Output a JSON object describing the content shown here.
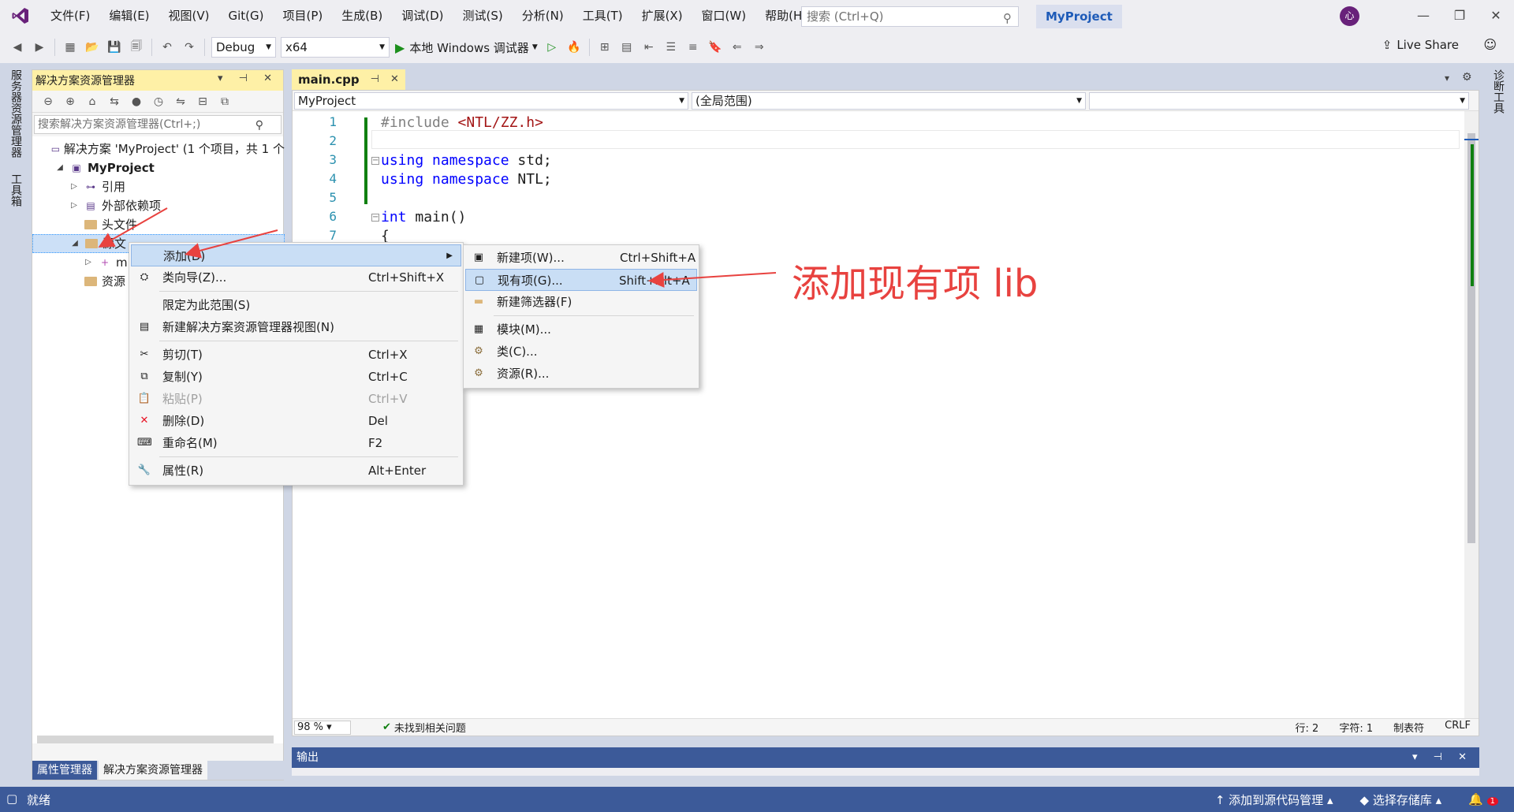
{
  "menu": [
    "文件(F)",
    "编辑(E)",
    "视图(V)",
    "Git(G)",
    "项目(P)",
    "生成(B)",
    "调试(D)",
    "测试(S)",
    "分析(N)",
    "工具(T)",
    "扩展(X)",
    "窗口(W)",
    "帮助(H)"
  ],
  "search": {
    "placeholder": "搜索 (Ctrl+Q)"
  },
  "project_title": "MyProject",
  "avatar_initial": "心",
  "toolbar": {
    "config": "Debug",
    "platform": "x64",
    "run_label": "本地 Windows 调试器",
    "live_share": "Live Share"
  },
  "left_tabs": [
    "服务器资源管理器",
    "工具箱"
  ],
  "right_tabs": [
    "诊断工具"
  ],
  "solution_explorer": {
    "title": "解决方案资源管理器",
    "search_placeholder": "搜索解决方案资源管理器(Ctrl+;)",
    "tree": [
      {
        "label": "解决方案 'MyProject' (1 个项目，共 1 个",
        "level": 0,
        "icon": "solution-icon",
        "expander": ""
      },
      {
        "label": "MyProject",
        "level": 1,
        "icon": "project-icon",
        "expander": "◢",
        "bold": true
      },
      {
        "label": "引用",
        "level": 2,
        "icon": "references-icon",
        "expander": "▷"
      },
      {
        "label": "外部依赖项",
        "level": 2,
        "icon": "external-deps-icon",
        "expander": "▷"
      },
      {
        "label": "头文件",
        "level": 2,
        "icon": "folder-icon",
        "expander": ""
      },
      {
        "label": "源文",
        "level": 2,
        "icon": "folder-icon",
        "expander": "◢",
        "selected": true
      },
      {
        "label": "m",
        "level": 3,
        "icon": "cpp-file-icon",
        "expander": "▷"
      },
      {
        "label": "资源",
        "level": 2,
        "icon": "folder-icon",
        "expander": ""
      }
    ],
    "bottom_tabs": [
      "属性管理器",
      "解决方案资源管理器"
    ]
  },
  "editor": {
    "tab": "main.cpp",
    "nav": {
      "project": "MyProject",
      "scope": "(全局范围)",
      "member": ""
    },
    "lines": [
      {
        "n": "1",
        "tokens": [
          {
            "t": "#include ",
            "c": "pp"
          },
          {
            "t": "<NTL/ZZ.h>",
            "c": "str"
          }
        ]
      },
      {
        "n": "2",
        "tokens": []
      },
      {
        "n": "3",
        "tokens": [
          {
            "t": "using",
            "c": "kw"
          },
          {
            "t": " "
          },
          {
            "t": "namespace",
            "c": "kw"
          },
          {
            "t": " std;"
          }
        ],
        "fold": true
      },
      {
        "n": "4",
        "tokens": [
          {
            "t": "using",
            "c": "kw"
          },
          {
            "t": " "
          },
          {
            "t": "namespace",
            "c": "kw"
          },
          {
            "t": " NTL;"
          }
        ]
      },
      {
        "n": "5",
        "tokens": []
      },
      {
        "n": "6",
        "tokens": [
          {
            "t": "int",
            "c": "kw"
          },
          {
            "t": " main()"
          }
        ],
        "fold": true
      },
      {
        "n": "7",
        "tokens": [
          {
            "t": "{"
          }
        ]
      }
    ],
    "status": {
      "zoom": "98 %",
      "issues": "未找到相关问题",
      "line": "行: 2",
      "char": "字符: 1",
      "tabs": "制表符",
      "eol": "CRLF"
    }
  },
  "output": {
    "title": "输出"
  },
  "statusbar": {
    "ready": "就绪",
    "source_control": "添加到源代码管理",
    "repo": "选择存储库",
    "notif_count": "1"
  },
  "context_menu": [
    {
      "label": "添加(D)",
      "shortcut": "",
      "icon": "",
      "submenu": true,
      "highlight": true
    },
    {
      "label": "类向导(Z)...",
      "shortcut": "Ctrl+Shift+X",
      "icon": "class-wizard-icon"
    },
    {
      "sep": true
    },
    {
      "label": "限定为此范围(S)",
      "shortcut": "",
      "icon": ""
    },
    {
      "label": "新建解决方案资源管理器视图(N)",
      "shortcut": "",
      "icon": "new-view-icon"
    },
    {
      "sep": true
    },
    {
      "label": "剪切(T)",
      "shortcut": "Ctrl+X",
      "icon": "cut-icon"
    },
    {
      "label": "复制(Y)",
      "shortcut": "Ctrl+C",
      "icon": "copy-icon"
    },
    {
      "label": "粘贴(P)",
      "shortcut": "Ctrl+V",
      "icon": "paste-icon",
      "disabled": true
    },
    {
      "label": "删除(D)",
      "shortcut": "Del",
      "icon": "delete-icon"
    },
    {
      "label": "重命名(M)",
      "shortcut": "F2",
      "icon": "rename-icon"
    },
    {
      "sep": true
    },
    {
      "label": "属性(R)",
      "shortcut": "Alt+Enter",
      "icon": "properties-icon"
    }
  ],
  "submenu": [
    {
      "label": "新建项(W)...",
      "shortcut": "Ctrl+Shift+A",
      "icon": "new-item-icon"
    },
    {
      "label": "现有项(G)...",
      "shortcut": "Shift+Alt+A",
      "icon": "existing-item-icon",
      "highlight": true
    },
    {
      "label": "新建筛选器(F)",
      "shortcut": "",
      "icon": "filter-folder-icon"
    },
    {
      "sep": true
    },
    {
      "label": "模块(M)...",
      "shortcut": "",
      "icon": "module-icon"
    },
    {
      "label": "类(C)...",
      "shortcut": "",
      "icon": "class-icon"
    },
    {
      "label": "资源(R)...",
      "shortcut": "",
      "icon": "resource-icon"
    }
  ],
  "annotation": "添加现有项 lib",
  "colors": {
    "accent": "#3c5a99",
    "highlight": "#fef0a6",
    "annotation": "#e8423f",
    "keyword": "#0000ff",
    "string": "#a31515"
  }
}
